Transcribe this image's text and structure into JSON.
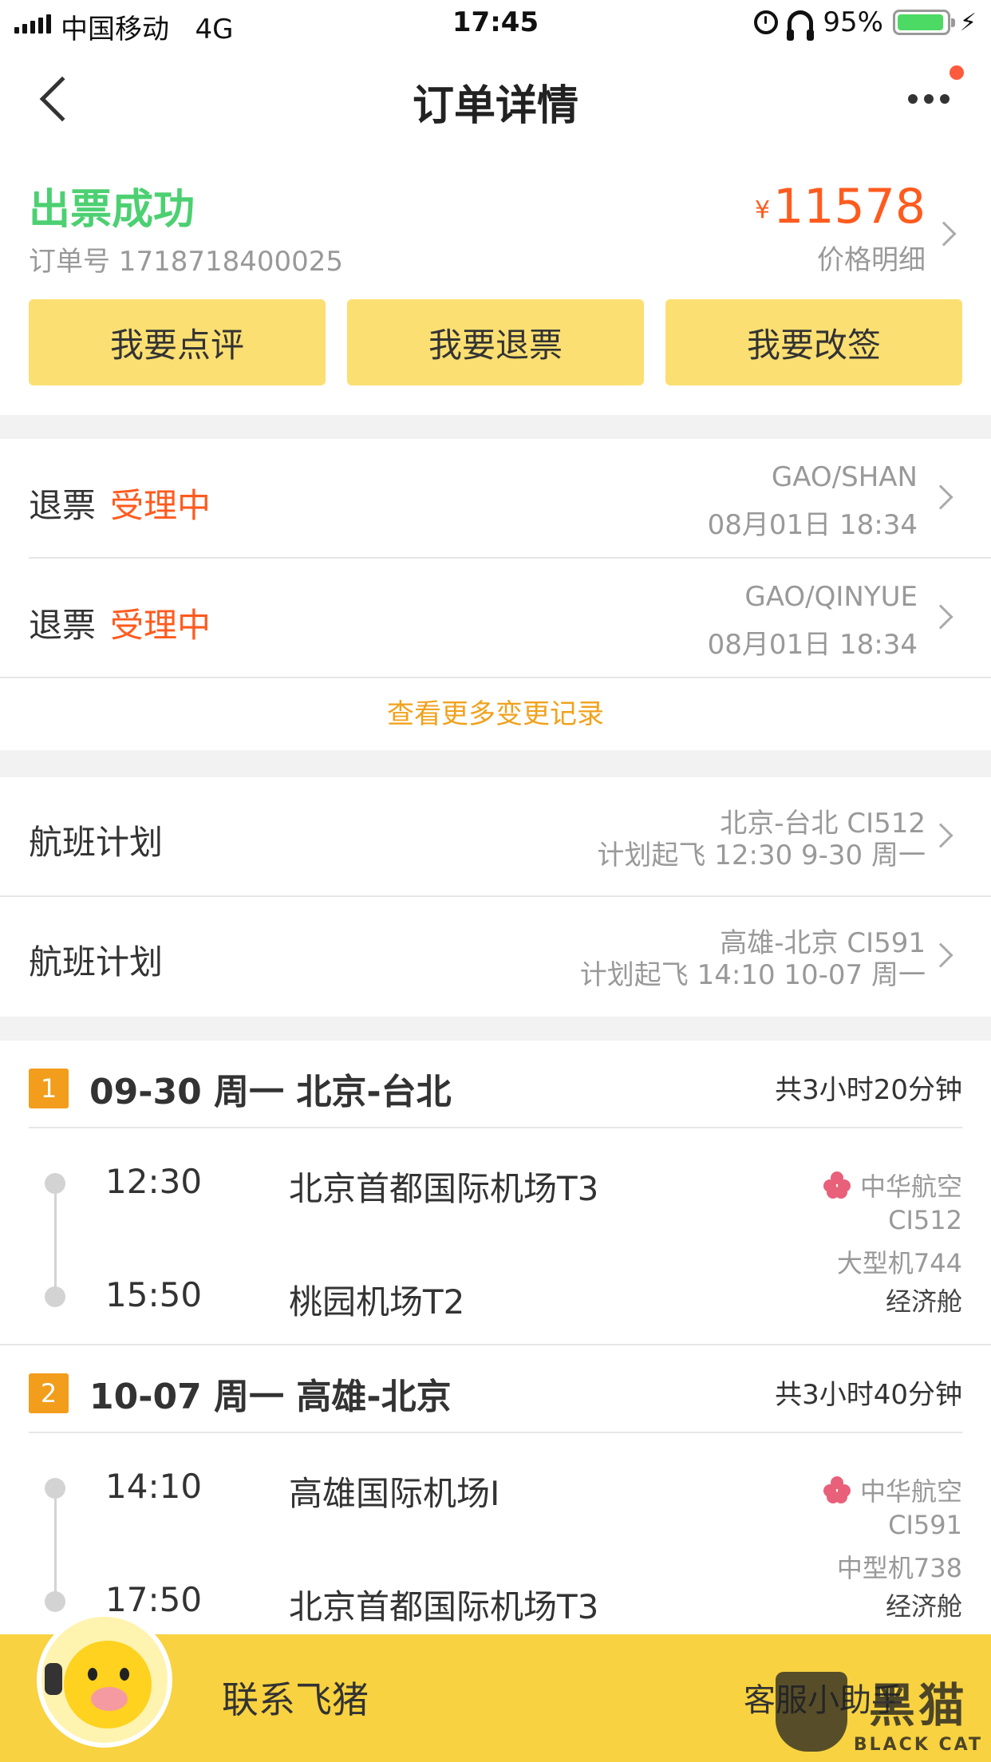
{
  "status_bar": {
    "carrier": "中国移动",
    "network": "4G",
    "time": "17:45",
    "battery": "95%",
    "battery_level": 0.95
  },
  "nav": {
    "title": "订单详情",
    "back_icon": "chevron-left-icon",
    "more_icon": "more-dots-icon",
    "badge_color": "#ff5a3c"
  },
  "summary": {
    "status": "出票成功",
    "order_number": "订单号 1718718400025",
    "currency": "¥",
    "price": "11578",
    "price_detail": "价格明细",
    "buttons": [
      "我要点评",
      "我要退票",
      "我要改签"
    ]
  },
  "refunds": [
    {
      "label": "退票",
      "status": "受理中",
      "passenger": "GAO/SHAN",
      "time": "08月01日 18:34"
    },
    {
      "label": "退票",
      "status": "受理中",
      "passenger": "GAO/QINYUE",
      "time": "08月01日 18:34"
    }
  ],
  "more_changes": "查看更多变更记录",
  "flight_plans": [
    {
      "label": "航班计划",
      "route": "北京-台北 CI512",
      "scheduled": "计划起飞 12:30 9-30 周一"
    },
    {
      "label": "航班计划",
      "route": "高雄-北京 CI591",
      "scheduled": "计划起飞 14:10 10-07 周一"
    }
  ],
  "segments": [
    {
      "index": "1",
      "title": "09-30 周一 北京-台北",
      "duration": "共3小时20分钟",
      "depart_time": "12:30",
      "depart_airport": "北京首都国际机场T3",
      "arrive_time": "15:50",
      "arrive_airport": "桃园机场T2",
      "airline": "中华航空",
      "flight_no": "CI512",
      "aircraft": "大型机744",
      "cabin": "经济舱"
    },
    {
      "index": "2",
      "title": "10-07 周一 高雄-北京",
      "duration": "共3小时40分钟",
      "depart_time": "14:10",
      "depart_airport": "高雄国际机场I",
      "arrive_time": "17:50",
      "arrive_airport": "北京首都国际机场T3",
      "airline": "中华航空",
      "flight_no": "CI591",
      "aircraft": "中型机738",
      "cabin": "经济舱"
    }
  ],
  "bottom_bar": {
    "contact": "联系飞猪",
    "assistant": "客服小助手",
    "watermark_cn": "黑猫",
    "watermark_en": "BLACK CAT"
  },
  "colors": {
    "success_green": "#4cd072",
    "price_orange": "#ff5b1f",
    "button_yellow": "#fbdf72",
    "link_orange": "#f0a21d",
    "badge_orange": "#f29d1c",
    "bottom_yellow": "#f8d240"
  }
}
